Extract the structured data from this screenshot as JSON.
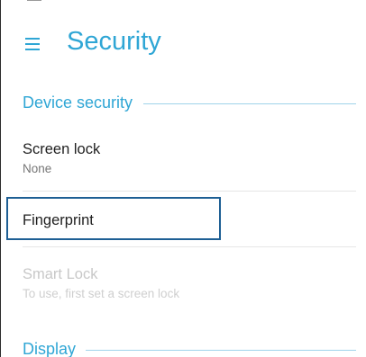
{
  "app_bar": {
    "title": "Security",
    "menu_icon": "hamburger-menu-icon",
    "accent_color": "#2fa6d5"
  },
  "sections": [
    {
      "title": "Device security",
      "items": [
        {
          "title": "Screen lock",
          "summary": "None",
          "enabled": true
        },
        {
          "title": "Fingerprint",
          "summary": "",
          "enabled": true,
          "focused": true
        },
        {
          "title": "Smart Lock",
          "summary": "To use, first set a screen lock",
          "enabled": false
        }
      ]
    },
    {
      "title": "Display",
      "items": []
    }
  ],
  "colors": {
    "accent": "#2fa6d5",
    "focus_ring": "#1e5f94",
    "primary_text": "#1f1f1f",
    "secondary_text": "#767676",
    "disabled_text": "#c8c8c8"
  }
}
